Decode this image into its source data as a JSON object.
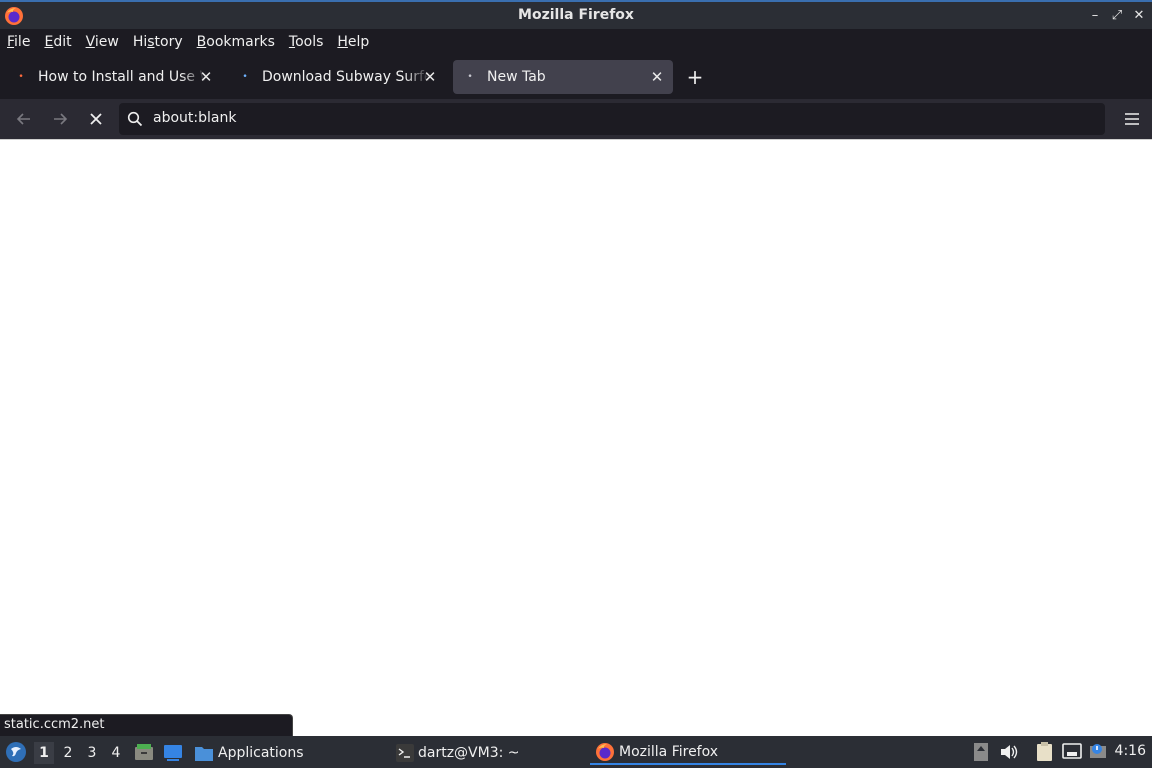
{
  "window": {
    "title": "Mozilla Firefox"
  },
  "menu": {
    "items": [
      {
        "key": "F",
        "rest": "ile"
      },
      {
        "key": "E",
        "rest": "dit"
      },
      {
        "key": "V",
        "rest": "iew"
      },
      {
        "pre": "Hi",
        "key": "s",
        "rest": "tory"
      },
      {
        "key": "B",
        "rest": "ookmarks"
      },
      {
        "key": "T",
        "rest": "ools"
      },
      {
        "key": "H",
        "rest": "elp"
      }
    ]
  },
  "tabs": [
    {
      "label": "How to Install and Use WinRAR",
      "dot_color": "#ff6a3d"
    },
    {
      "label": "Download Subway Surfers",
      "dot_color": "#6fb3ff"
    },
    {
      "label": "New Tab",
      "dot_color": "#c8c8d0"
    }
  ],
  "navbar": {
    "url": "about:blank"
  },
  "status": {
    "text": "static.ccm2.net"
  },
  "taskbar": {
    "workspaces": [
      "1",
      "2",
      "3",
      "4"
    ],
    "applications_label": "Applications",
    "terminal_label": "dartz@VM3: ~",
    "firefox_label": "Mozilla Firefox",
    "clock": "4:16"
  },
  "colors": {
    "accent": "#3584e4",
    "titlebar": "#2b2e35",
    "chrome": "#1c1b22"
  }
}
